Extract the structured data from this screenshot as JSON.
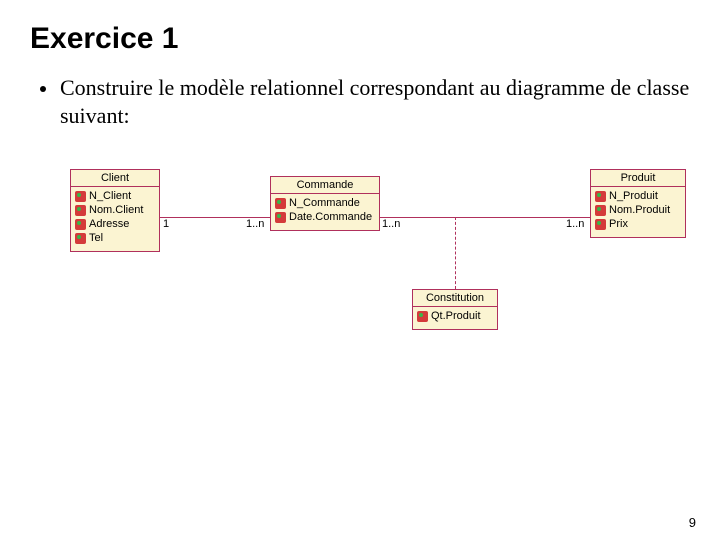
{
  "title": "Exercice 1",
  "bullet": "Construire le modèle relationnel correspondant au diagramme de classe suivant:",
  "classes": {
    "client": {
      "name": "Client",
      "attrs": [
        "N_Client",
        "Nom.Client",
        "Adresse",
        "Tel"
      ]
    },
    "commande": {
      "name": "Commande",
      "attrs": [
        "N_Commande",
        "Date.Commande"
      ]
    },
    "produit": {
      "name": "Produit",
      "attrs": [
        "N_Produit",
        "Nom.Produit",
        "Prix"
      ]
    },
    "constitution": {
      "name": "Constitution",
      "attrs": [
        "Qt.Produit"
      ]
    }
  },
  "mults": {
    "client_commande_left": "1",
    "client_commande_right": "1..n",
    "commande_produit_left": "1..n",
    "commande_produit_right": "1..n"
  },
  "page": "9"
}
